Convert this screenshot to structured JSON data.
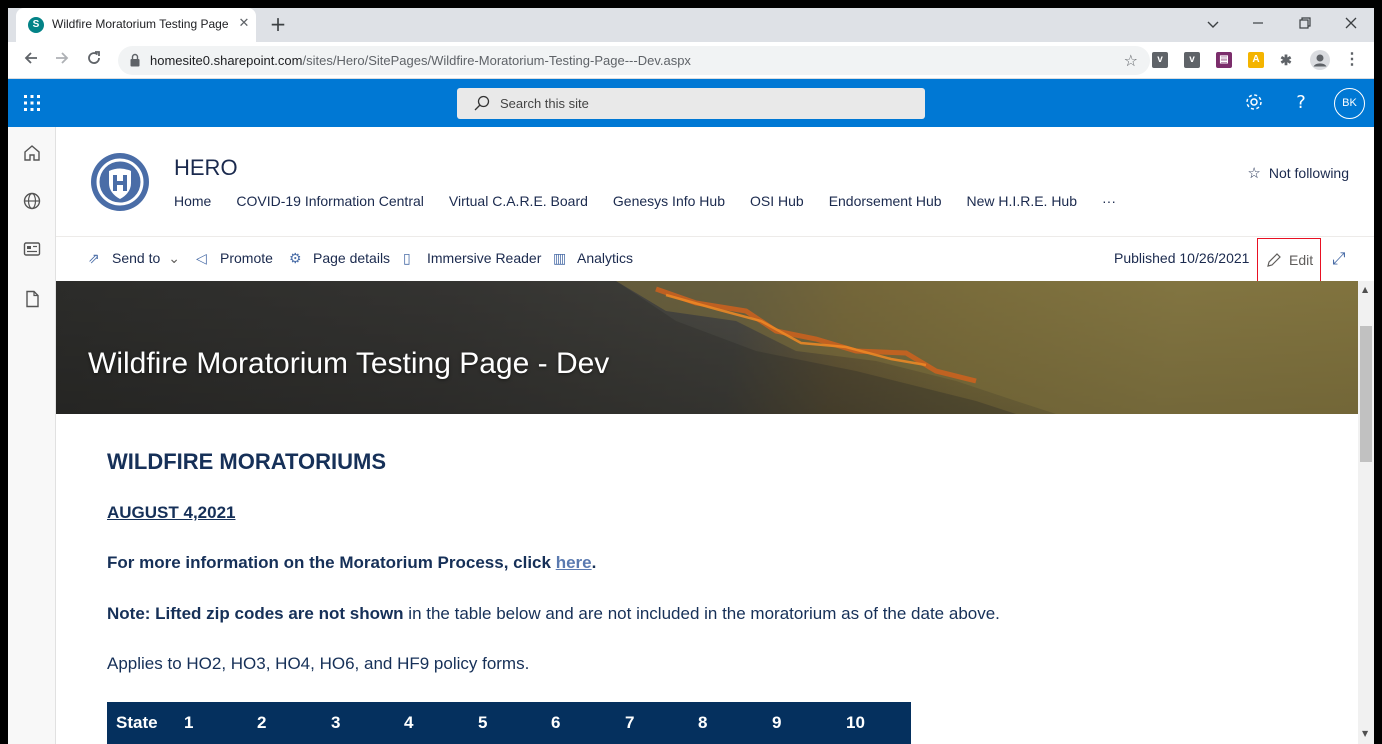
{
  "browser": {
    "tab_title": "Wildfire Moratorium Testing Page - Dev",
    "tab_close": "✕",
    "new_tab": "+",
    "url_host": "homesite0.sharepoint.com",
    "url_path": "/sites/Hero/SitePages/Wildfire-Moratorium-Testing-Page---Dev.aspx",
    "extensions": [
      {
        "label": "v",
        "color": "#5f6368"
      },
      {
        "label": "v",
        "color": "#5f6368"
      },
      {
        "label": "▤",
        "color": "#7b2d6b"
      },
      {
        "label": "A",
        "color": "#f4b400"
      }
    ]
  },
  "suitebar": {
    "search_placeholder": "Search this site",
    "avatar_initials": "BK",
    "help": "?"
  },
  "site": {
    "title": "HERO",
    "nav": [
      "Home",
      "COVID-19 Information Central",
      "Virtual C.A.R.E. Board",
      "Genesys Info Hub",
      "OSI Hub",
      "Endorsement Hub",
      "New H.I.R.E. Hub",
      "···"
    ],
    "follow_label": "Not following"
  },
  "commands": {
    "send_to": "Send to",
    "promote": "Promote",
    "page_details": "Page details",
    "immersive_reader": "Immersive Reader",
    "analytics": "Analytics",
    "published": "Published 10/26/2021",
    "edit": "Edit"
  },
  "page": {
    "hero_title": "Wildfire Moratorium Testing Page - Dev",
    "heading": "WILDFIRE MORATORIUMS",
    "date": "AUGUST 4,2021",
    "info_text": "For more information on the Moratorium Process, click ",
    "info_link": "here",
    "info_end": ".",
    "note_bold": "Note: Lifted zip codes are not shown",
    "note_rest": " in the table below and are not included in the moratorium as of the date above.",
    "applies": "Applies to HO2, HO3, HO4, HO6, and HF9 policy forms.",
    "table_headers": [
      "State",
      "1",
      "2",
      "3",
      "4",
      "5",
      "6",
      "7",
      "8",
      "9",
      "10"
    ]
  },
  "colors": {
    "suite_blue": "#0078d4",
    "header_navy": "#05305e",
    "text_navy": "#163058",
    "edit_border": "#e81123"
  }
}
